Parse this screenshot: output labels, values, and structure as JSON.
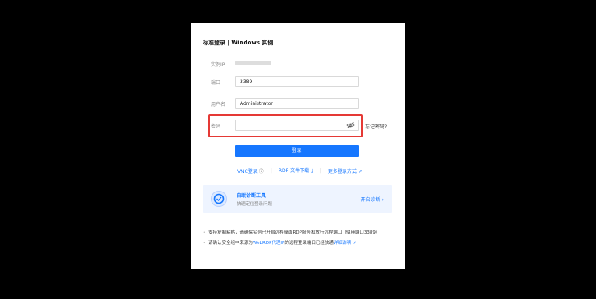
{
  "dialog": {
    "title": "标准登录 | Windows 实例"
  },
  "form": {
    "instance_ip_label": "实例IP",
    "port_label": "端口",
    "port_value": "3389",
    "username_label": "用户名",
    "username_value": "Administrator",
    "password_label": "密码",
    "password_value": "",
    "forgot_password": "忘记密码?"
  },
  "buttons": {
    "login": "登录"
  },
  "links": {
    "vnc": "VNC登录",
    "rdp": "RDP 文件下载",
    "more": "更多登录方式"
  },
  "tool": {
    "title": "自助诊断工具",
    "desc": "快速定位登录问题",
    "action": "开启诊断"
  },
  "notes": {
    "note1": "支持复制粘贴，请确保实例已开启远程桌面RDP服务和放行远程端口（使用端口3389）",
    "note2_prefix": "请确认安全组中来源为",
    "note2_link": "WebRDP代理IP",
    "note2_mid": "的远程登录端口已经放通",
    "note2_link2": "详细说明"
  },
  "icons": {
    "eye": "eye-off-icon",
    "info": "info-icon",
    "download": "download-icon",
    "external": "external-link-icon",
    "chevron": "chevron-right-icon"
  },
  "colors": {
    "accent": "#1677ff",
    "highlight": "#e53935"
  }
}
